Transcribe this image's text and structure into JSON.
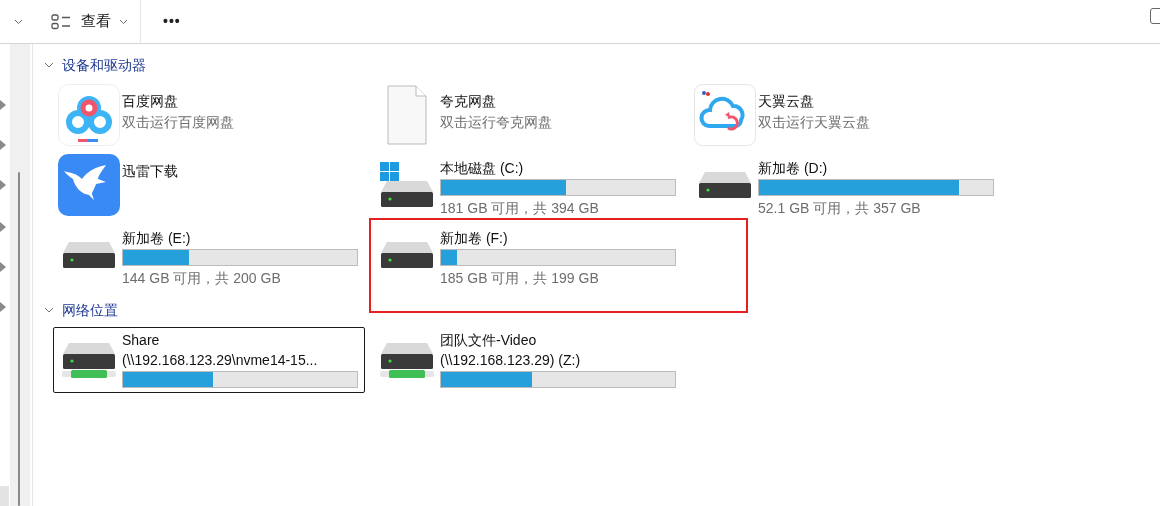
{
  "toolbar": [
    {
      "kind": "view",
      "label": "查看"
    },
    {
      "kind": "more",
      "label": "•••"
    }
  ],
  "sections": [
    {
      "title": "设备和驱动器",
      "expanded": true,
      "items": [
        {
          "kind": "app",
          "name": "百度网盘",
          "subtitle": "双击运行百度网盘",
          "selected": false,
          "highlighted": false
        },
        {
          "kind": "app",
          "name": "夸克网盘",
          "subtitle": "双击运行夸克网盘",
          "selected": false,
          "highlighted": false
        },
        {
          "kind": "app",
          "name": "天翼云盘",
          "subtitle": "双击运行天翼云盘",
          "selected": false,
          "highlighted": false
        },
        {
          "kind": "app",
          "name": "迅雷下载",
          "selected": false,
          "highlighted": false
        },
        {
          "kind": "system_drive",
          "name": "本地磁盘 (C:)",
          "level": 0.536,
          "subtitle": "181 GB 可用，共 394 GB",
          "selected": false,
          "highlighted": false
        },
        {
          "kind": "drive",
          "name": "新加卷 (D:)",
          "level": 0.854,
          "subtitle": "52.1 GB 可用，共 357 GB",
          "selected": false,
          "highlighted": false
        },
        {
          "kind": "drive",
          "name": "新加卷 (E:)",
          "level": 0.28,
          "subtitle": "144 GB 可用，共 200 GB",
          "selected": false,
          "highlighted": false
        },
        {
          "kind": "drive",
          "name": "新加卷 (F:)",
          "level": 0.07,
          "subtitle": "185 GB 可用，共 199 GB",
          "selected": false,
          "highlighted": true
        }
      ]
    },
    {
      "title": "网络位置",
      "expanded": true,
      "items": [
        {
          "kind": "network_drive",
          "name": "Share",
          "path": "(\\\\192.168.123.29\\nvme14-15...",
          "level": 0.385,
          "selected": true,
          "highlighted": false
        },
        {
          "kind": "network_drive",
          "name": "团队文件-Video",
          "path": "(\\\\192.168.123.29) (Z:)",
          "level": 0.39,
          "selected": false,
          "highlighted": false
        }
      ]
    }
  ]
}
